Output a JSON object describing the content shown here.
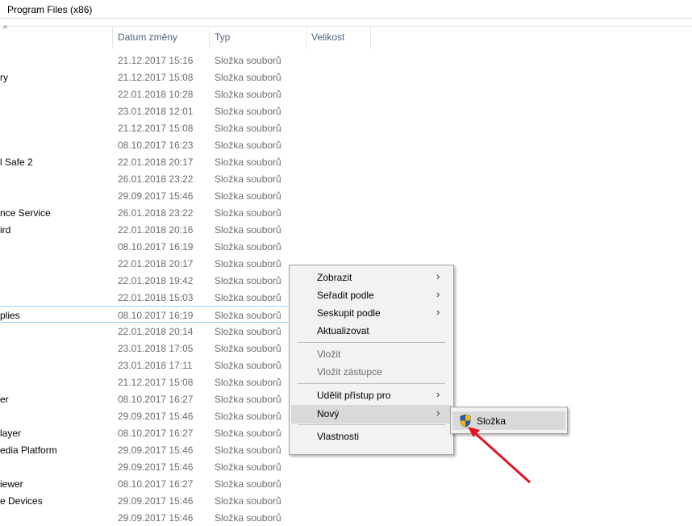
{
  "title": "Program Files (x86)",
  "columns": {
    "date": "Datum změny",
    "type": "Typ",
    "size": "Velikost"
  },
  "rows": [
    {
      "name": "",
      "date": "21.12.2017 15:16",
      "type": "Složka souborů"
    },
    {
      "name": "ry",
      "date": "21.12.2017 15:08",
      "type": "Složka souborů"
    },
    {
      "name": "",
      "date": "22.01.2018 10:28",
      "type": "Složka souborů"
    },
    {
      "name": "",
      "date": "23.01.2018 12:01",
      "type": "Složka souborů"
    },
    {
      "name": "",
      "date": "21.12.2017 15:08",
      "type": "Složka souborů"
    },
    {
      "name": "",
      "date": "08.10.2017 16:23",
      "type": "Složka souborů"
    },
    {
      "name": "l Safe 2",
      "date": "22.01.2018 20:17",
      "type": "Složka souborů"
    },
    {
      "name": "",
      "date": "26.01.2018 23:22",
      "type": "Složka souborů"
    },
    {
      "name": "",
      "date": "29.09.2017 15:46",
      "type": "Složka souborů"
    },
    {
      "name": "nce Service",
      "date": "26.01.2018 23:22",
      "type": "Složka souborů"
    },
    {
      "name": "ird",
      "date": "22.01.2018 20:16",
      "type": "Složka souborů"
    },
    {
      "name": "",
      "date": "08.10.2017 16:19",
      "type": "Složka souborů"
    },
    {
      "name": "",
      "date": "22.01.2018 20:17",
      "type": "Složka souborů"
    },
    {
      "name": "",
      "date": "22.01.2018 19:42",
      "type": "Složka souborů"
    },
    {
      "name": "",
      "date": "22.01.2018 15:03",
      "type": "Složka souborů"
    },
    {
      "name": "plies",
      "date": "08.10.2017 16:19",
      "type": "Složka souborů"
    },
    {
      "name": "",
      "date": "22.01.2018 20:14",
      "type": "Složka souborů"
    },
    {
      "name": "",
      "date": "23.01.2018 17:05",
      "type": "Složka souborů"
    },
    {
      "name": "",
      "date": "23.01.2018 17:11",
      "type": "Složka souborů"
    },
    {
      "name": "",
      "date": "21.12.2017 15:08",
      "type": "Složka souborů"
    },
    {
      "name": "er",
      "date": "08.10.2017 16:27",
      "type": "Složka souborů"
    },
    {
      "name": "",
      "date": "29.09.2017 15:46",
      "type": "Složka souborů"
    },
    {
      "name": "layer",
      "date": "08.10.2017 16:27",
      "type": "Složka souborů"
    },
    {
      "name": "edia Platform",
      "date": "29.09.2017 15:46",
      "type": "Složka souborů"
    },
    {
      "name": "",
      "date": "29.09.2017 15:46",
      "type": "Složka souborů"
    },
    {
      "name": "iewer",
      "date": "08.10.2017 16:27",
      "type": "Složka souborů"
    },
    {
      "name": "e Devices",
      "date": "29.09.2017 15:46",
      "type": "Složka souborů"
    },
    {
      "name": "",
      "date": "29.09.2017 15:46",
      "type": "Složka souborů"
    }
  ],
  "menu": {
    "items": [
      {
        "label": "Zobrazit",
        "submenu": true,
        "disabled": false
      },
      {
        "label": "Seřadit podle",
        "submenu": true,
        "disabled": false
      },
      {
        "label": "Seskupit podle",
        "submenu": true,
        "disabled": false
      },
      {
        "label": "Aktualizovat",
        "submenu": false,
        "disabled": false
      },
      {
        "sep": true
      },
      {
        "label": "Vložit",
        "submenu": false,
        "disabled": true
      },
      {
        "label": "Vložit zástupce",
        "submenu": false,
        "disabled": true
      },
      {
        "sep": true
      },
      {
        "label": "Udělit přístup pro",
        "submenu": true,
        "disabled": false
      },
      {
        "label": "Nový",
        "submenu": true,
        "disabled": false,
        "highlighted": true
      },
      {
        "sep": true
      },
      {
        "label": "Vlastnosti",
        "submenu": false,
        "disabled": false
      }
    ]
  },
  "submenu": {
    "item": "Složka",
    "icon": "uac-shield-icon"
  },
  "colors": {
    "arrow": "#e81123",
    "focus": "#99d1ff",
    "highlight": "#d9d9d9"
  }
}
